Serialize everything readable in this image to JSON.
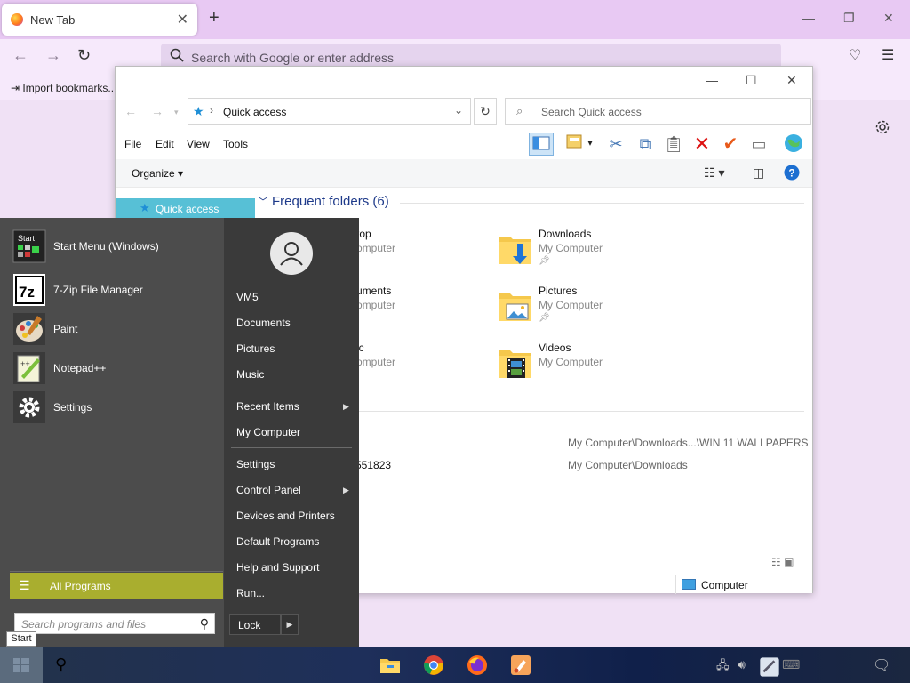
{
  "browser": {
    "tab_title": "New Tab",
    "address_placeholder": "Search with Google or enter address",
    "bookmark_import": "Import bookmarks..."
  },
  "explorer": {
    "location": "Quick access",
    "search_placeholder": "Search Quick access",
    "menu": [
      "File",
      "Edit",
      "View",
      "Tools"
    ],
    "organize_label": "Organize",
    "nav_quick_access": "Quick access",
    "group_title": "Frequent folders (6)",
    "folders": [
      {
        "name": "Desktop",
        "location": "My Computer",
        "visible_name": "top",
        "visible_location": "omputer"
      },
      {
        "name": "Downloads",
        "location": "My Computer"
      },
      {
        "name": "Documents",
        "location": "My Computer",
        "visible_name": "uments",
        "visible_location": "omputer"
      },
      {
        "name": "Pictures",
        "location": "My Computer"
      },
      {
        "name": "Music",
        "location": "My Computer",
        "visible_name": "ic",
        "visible_location": "omputer"
      },
      {
        "name": "Videos",
        "location": "My Computer"
      }
    ],
    "recent_group_fragment": ")",
    "recent_files": [
      {
        "name_fragment": "",
        "path": "My Computer\\Downloads...\\WIN 11 WALLPAPERS"
      },
      {
        "name_fragment": "551823",
        "path": "My Computer\\Downloads"
      }
    ],
    "status_location": "Computer"
  },
  "start_menu": {
    "pinned": [
      {
        "label": "Start Menu (Windows)",
        "icon": "start-menu-icon"
      },
      {
        "label": "7-Zip File Manager",
        "icon": "seven-zip-icon"
      },
      {
        "label": "Paint",
        "icon": "paint-icon"
      },
      {
        "label": "Notepad++",
        "icon": "notepadpp-icon"
      },
      {
        "label": "Settings",
        "icon": "gear-icon"
      }
    ],
    "all_programs": "All Programs",
    "search_placeholder": "Search programs and files",
    "start_tooltip": "Start",
    "right_items": [
      "VM5",
      "Documents",
      "Pictures",
      "Music",
      "Recent Items",
      "My Computer",
      "Settings",
      "Control Panel",
      "Devices and Printers",
      "Default Programs",
      "Help and Support",
      "Run..."
    ],
    "lock_label": "Lock"
  },
  "colors": {
    "accent_all_programs": "#a9ae2f",
    "quick_access_highlight": "#57c0d6",
    "firefox_tabstrip": "#e8c9f3"
  }
}
